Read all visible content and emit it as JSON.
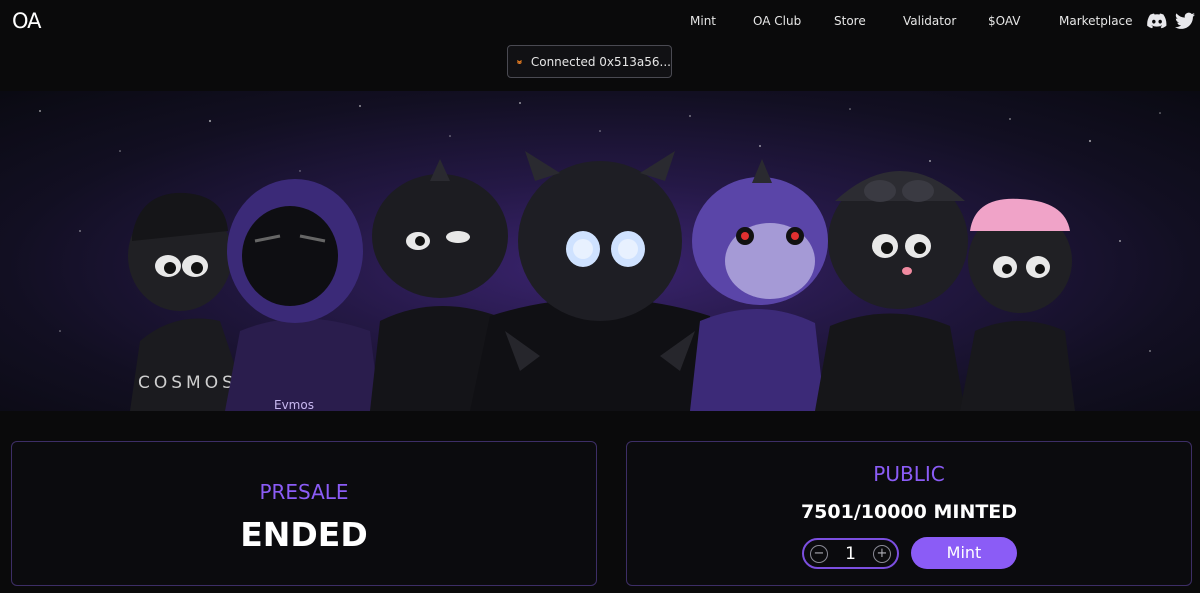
{
  "header": {
    "logo_text": "OA",
    "nav": [
      {
        "label": "Mint"
      },
      {
        "label": "OA Club"
      },
      {
        "label": "Store"
      },
      {
        "label": "Validator"
      },
      {
        "label": "$OAV"
      },
      {
        "label": "Marketplace"
      }
    ],
    "social_icons": [
      "discord-icon",
      "twitter-icon"
    ]
  },
  "wallet": {
    "icon": "metamask-fox-icon",
    "label": "Connected 0x513a56..."
  },
  "hero": {
    "apparel_text_left": "COSMOS",
    "apparel_text_second": "Evmos"
  },
  "presale": {
    "title": "PRESALE",
    "status": "ENDED"
  },
  "public": {
    "title": "PUBLIC",
    "minted_text": "7501/10000 MINTED",
    "quantity": "1",
    "decrement_symbol": "−",
    "increment_symbol": "+",
    "mint_label": "Mint"
  },
  "colors": {
    "accent": "#8b5cf6",
    "background": "#0a0a0b",
    "card_border": "#3d2e66"
  }
}
